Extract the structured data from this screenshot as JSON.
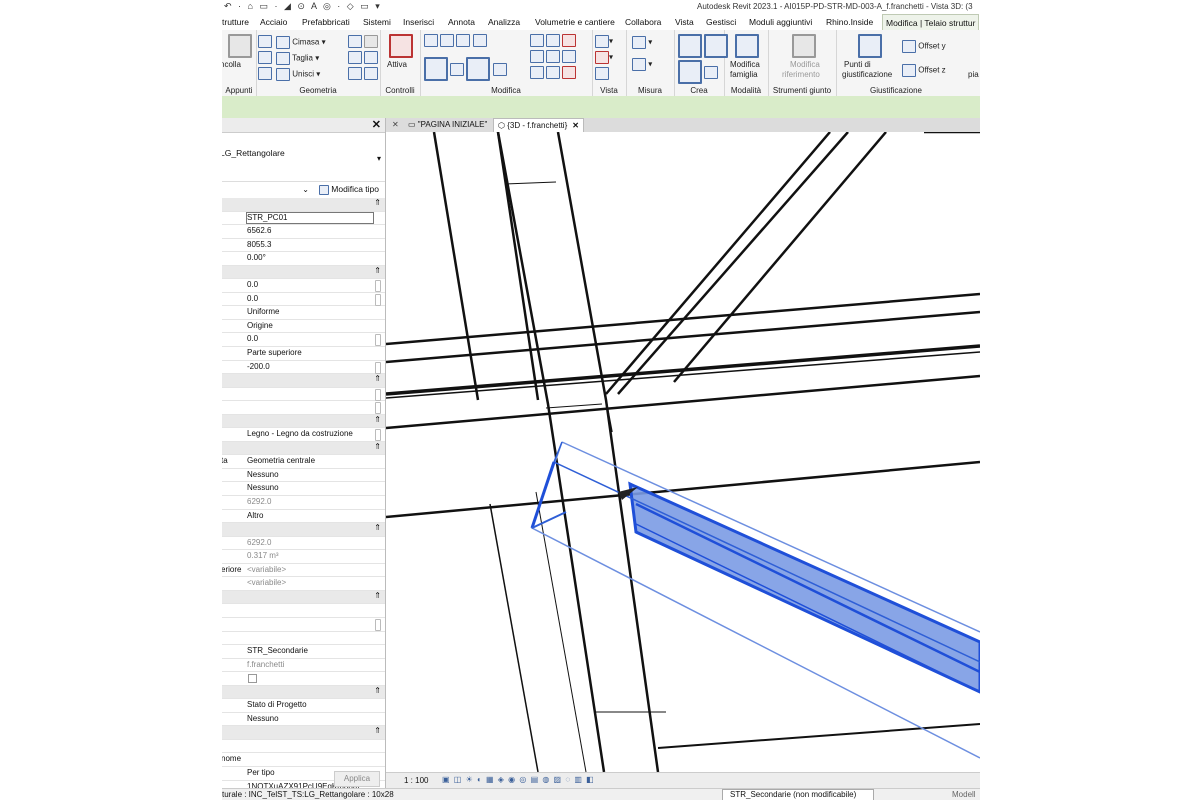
{
  "titlebar": {
    "quick_access": "↶ · ⌂ ▭ · ◢ ⊙ A ◎ · ◇ ▭ ▾",
    "title": "Autodesk Revit 2023.1 - AI015P-PD-STR-MD-003-A_f.franchetti - Vista 3D: (3"
  },
  "menu_tabs": [
    "trutture",
    "Acciaio",
    "Prefabbricati",
    "Sistemi",
    "Inserisci",
    "Annota",
    "Analizza",
    "Volumetrie e cantiere",
    "Collabora",
    "Vista",
    "Gestisci",
    "Moduli aggiuntivi",
    "Rhino.Inside",
    "Modifica | Telaio struttur"
  ],
  "ribbon": {
    "appunti": {
      "label": "Appunti",
      "paste": "ncolla"
    },
    "geometria": {
      "label": "Geometria",
      "items": [
        "Cimasa",
        "Taglia",
        "Unisci"
      ]
    },
    "controlli": {
      "label": "Controlli",
      "attiva": "Attiva"
    },
    "modifica": {
      "label": "Modifica"
    },
    "vista": {
      "label": "Vista"
    },
    "misura": {
      "label": "Misura"
    },
    "crea": {
      "label": "Crea"
    },
    "modalita": {
      "label": "Modalità",
      "button_line1": "Modifica",
      "button_line2": "famiglia"
    },
    "strumenti_giunto": {
      "label": "Strumenti giunto",
      "button_line1": "Modifica",
      "button_line2": "riferimento"
    },
    "giustificazione": {
      "label": "Giustificazione",
      "punti_line1": "Punti di",
      "punti_line2": "giustificazione",
      "offset_y": "Offset y",
      "offset_z": "Offset z",
      "pia": "pia"
    }
  },
  "properties": {
    "type_name": "LG_Rettangolare",
    "edit_type": "Modifica tipo",
    "apply": "Applica",
    "rows": [
      {
        "kind": "sec"
      },
      {
        "key": "",
        "value": "STR_PC01",
        "boxed": true
      },
      {
        "key": "",
        "value": "6562.6"
      },
      {
        "key": "",
        "value": "8055.3"
      },
      {
        "key": "",
        "value": "0.00°"
      },
      {
        "kind": "sec"
      },
      {
        "key": "",
        "value": "0.0",
        "scroll": true
      },
      {
        "key": "",
        "value": "0.0",
        "scroll": true
      },
      {
        "key": "",
        "value": "Uniforme"
      },
      {
        "key": "",
        "value": "Origine"
      },
      {
        "key": "",
        "value": "0.0",
        "scroll": true
      },
      {
        "key": "",
        "value": "Parte superiore"
      },
      {
        "key": "",
        "value": "-200.0",
        "scroll": true
      },
      {
        "kind": "sec"
      },
      {
        "key": "",
        "value": "",
        "scroll": true
      },
      {
        "key": "",
        "value": "",
        "scroll": true
      },
      {
        "kind": "sec"
      },
      {
        "key": "",
        "value": "Legno - Legno da costruzione",
        "scroll": true
      },
      {
        "kind": "sec"
      },
      {
        "key": "ta",
        "value": "Geometria centrale"
      },
      {
        "key": "",
        "value": "Nessuno"
      },
      {
        "key": "",
        "value": "Nessuno"
      },
      {
        "key": "",
        "value": "6292.0",
        "dim": true
      },
      {
        "key": "",
        "value": "Altro"
      },
      {
        "kind": "sec"
      },
      {
        "key": "",
        "value": "6292.0",
        "dim": true
      },
      {
        "key": "",
        "value": "0.317 m³",
        "dim": true
      },
      {
        "key": "eriore",
        "value": "<variabile>",
        "dim": true
      },
      {
        "key": "",
        "value": "<variabile>",
        "dim": true
      },
      {
        "kind": "sec"
      },
      {
        "key": "",
        "value": ""
      },
      {
        "key": "",
        "value": "",
        "scroll": true
      },
      {
        "key": "",
        "value": ""
      },
      {
        "key": "",
        "value": "STR_Secondarie"
      },
      {
        "key": "",
        "value": "f.franchetti",
        "dim": true
      },
      {
        "key": "",
        "value": "",
        "checkbox": true
      },
      {
        "kind": "sec"
      },
      {
        "key": "",
        "value": "Stato di Progetto"
      },
      {
        "key": "",
        "value": "Nessuno"
      },
      {
        "kind": "sec"
      },
      {
        "key": "",
        "value": ""
      },
      {
        "key": "nome",
        "value": ""
      },
      {
        "key": "",
        "value": "Per tipo"
      },
      {
        "key": "",
        "value": "1NOTXuAZX91PcU9EgKmhom"
      }
    ]
  },
  "view_tabs": [
    {
      "label": "\"PAGINA INIZIALE\"",
      "active": false
    },
    {
      "label": "{3D - f.franchetti}",
      "active": true
    }
  ],
  "view_bar": {
    "scale": "1 : 100",
    "icons": "▣ ◫ ☀ ◐ ▦ ◈ ◉ ◎ ▤ ◍ ▨ ◌ ▥ ◧"
  },
  "status": {
    "left": "turale : INC_TelST_TS:LG_Rettangolare : 10x28",
    "workset": "STR_Secondarie (non modificabile)",
    "model": "Modell"
  },
  "colors": {
    "selection": "#2f5fd6",
    "selection_fill": "#6d8fe0",
    "context_tab": "#d9ecc9"
  }
}
